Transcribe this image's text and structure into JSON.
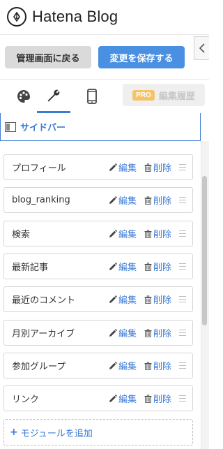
{
  "header": {
    "app_title": "Hatena Blog"
  },
  "actions": {
    "back_label": "管理画面に戻る",
    "save_label": "変更を保存する"
  },
  "tabs": {
    "pro_badge": "PRO",
    "pro_label": "編集履歴"
  },
  "section": {
    "title": "サイドバー"
  },
  "module_actions": {
    "edit_label": "編集",
    "delete_label": "削除"
  },
  "modules": [
    {
      "label": "プロフィール"
    },
    {
      "label": "blog_ranking"
    },
    {
      "label": "検索"
    },
    {
      "label": "最新記事"
    },
    {
      "label": "最近のコメント"
    },
    {
      "label": "月別アーカイブ"
    },
    {
      "label": "参加グループ"
    },
    {
      "label": "リンク"
    }
  ],
  "add_module": {
    "label": "モジュールを追加"
  },
  "colors": {
    "accent": "#3a7bd5",
    "save_button": "#4a90e2",
    "pro_badge": "#f5c469"
  }
}
